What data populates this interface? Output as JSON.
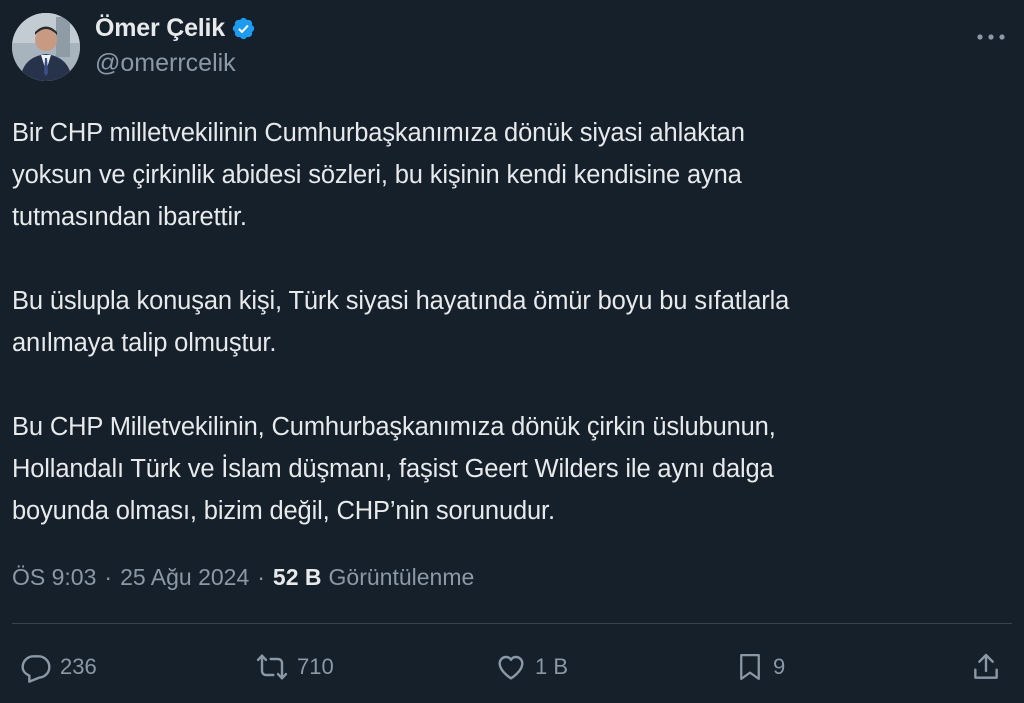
{
  "author": {
    "display_name": "Ömer Çelik",
    "handle": "@omerrcelik",
    "verified": true
  },
  "tweet": {
    "paragraphs": [
      {
        "lines": [
          "Bir CHP milletvekilinin Cumhurbaşkanımıza dönük siyasi ahlaktan",
          "yoksun ve çirkinlik abidesi sözleri, bu kişinin kendi kendisine ayna",
          "tutmasından ibarettir."
        ]
      },
      {
        "lines": [
          "Bu üslupla konuşan kişi, Türk siyasi hayatında ömür boyu bu sıfatlarla",
          "anılmaya talip olmuştur."
        ]
      },
      {
        "lines": [
          "Bu CHP Milletvekilinin, Cumhurbaşkanımıza dönük çirkin üslubunun,",
          "Hollandalı Türk ve İslam düşmanı, faşist Geert Wilders ile aynı dalga",
          "boyunda olması, bizim değil, CHP’nin sorunudur."
        ]
      }
    ]
  },
  "meta": {
    "time": "ÖS 9:03",
    "separator": "·",
    "date": "25 Ağu 2024",
    "views_count": "52 B",
    "views_label": "Görüntülenme"
  },
  "actions": {
    "replies": "236",
    "retweets": "710",
    "likes": "1 B",
    "bookmarks": "9"
  },
  "colors": {
    "background": "#15202b",
    "text_primary": "#e7e9ea",
    "text_secondary": "#8b98a5",
    "verified_badge": "#1d9bf0",
    "divider": "#38444d"
  },
  "icons": {
    "verified": "verified-badge-icon",
    "more": "more-horizontal-icon",
    "reply": "reply-icon",
    "retweet": "retweet-icon",
    "like": "heart-icon",
    "bookmark": "bookmark-icon",
    "share": "share-icon"
  }
}
